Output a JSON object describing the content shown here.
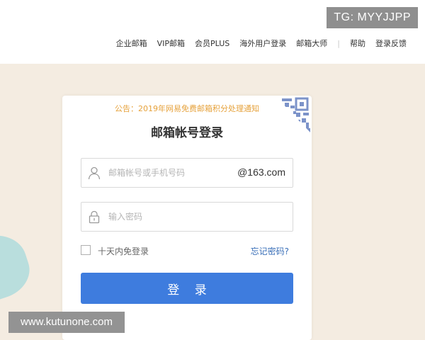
{
  "badge": {
    "text": "TG: MYYJJPP"
  },
  "top_nav": {
    "items": [
      "企业邮箱",
      "VIP邮箱",
      "会员PLUS",
      "海外用户登录",
      "邮箱大师",
      "帮助",
      "登录反馈"
    ],
    "separator": "|"
  },
  "login": {
    "notice": "公告：2019年网易免费邮箱积分处理通知",
    "title": "邮箱帐号登录",
    "username_placeholder": "邮箱帐号或手机号码",
    "username_value": "",
    "domain_suffix": "@163.com",
    "password_placeholder": "输入密码",
    "password_value": "",
    "remember_label": "十天内免登录",
    "remember_checked": false,
    "forgot_label": "忘记密码?",
    "submit_label": "登 录"
  },
  "watermark": {
    "text": "www.kutunone.com"
  },
  "icons": {
    "user": "user-icon",
    "password": "lock-icon",
    "qr": "qr-code-icon"
  },
  "colors": {
    "background": "#f4ece1",
    "notice": "#e6a23c",
    "primary_button": "#3e7cde",
    "link": "#3a6fb8",
    "qr_corner": "#7c93c9",
    "badge_bg": "#8f8f8f"
  }
}
